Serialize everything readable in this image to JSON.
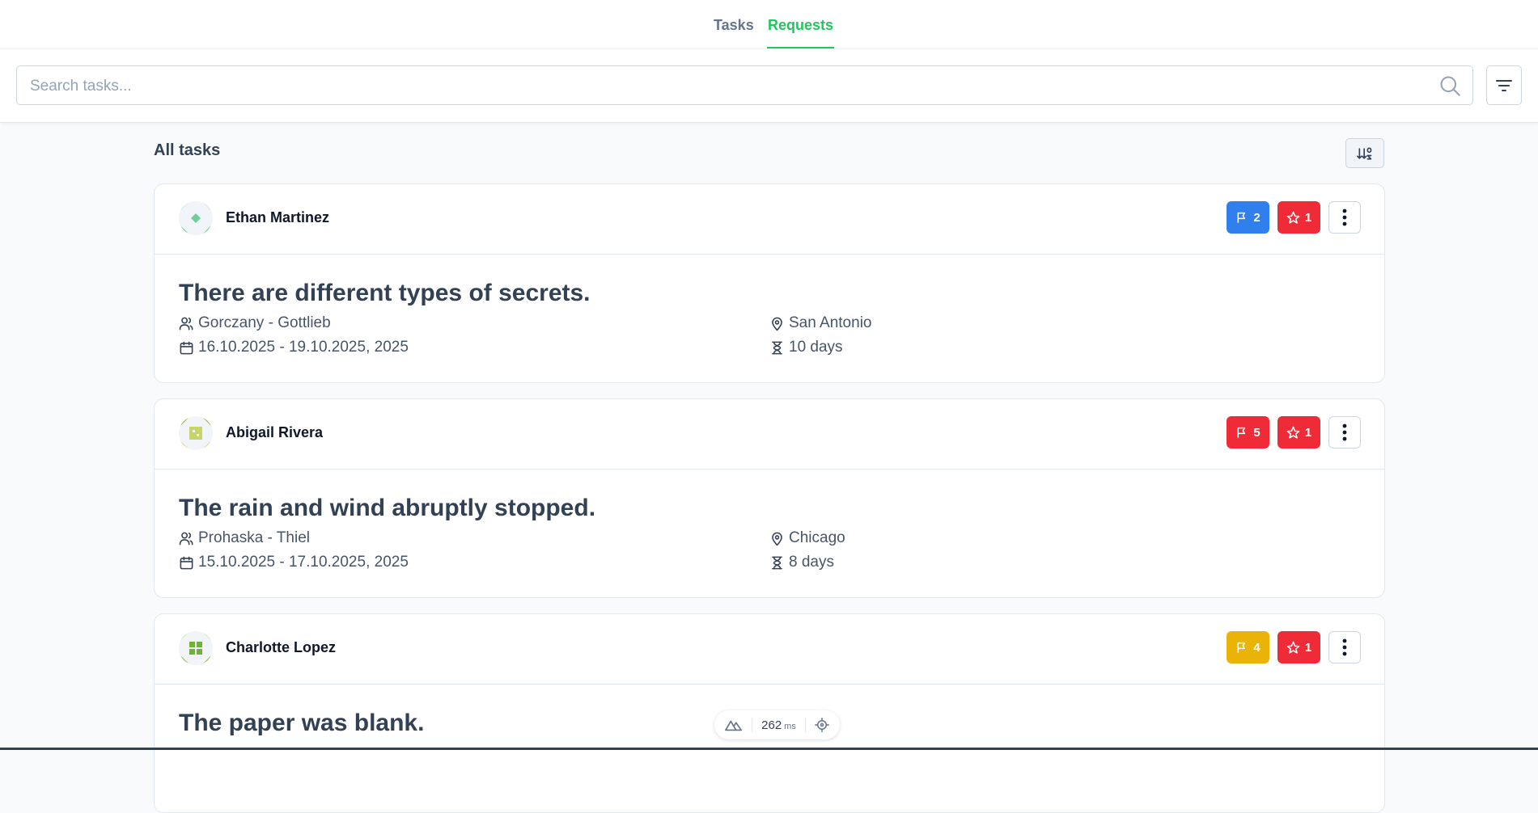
{
  "nav": {
    "tabs": [
      {
        "label": "Tasks",
        "active": false
      },
      {
        "label": "Requests",
        "active": true
      }
    ]
  },
  "search": {
    "placeholder": "Search tasks...",
    "value": ""
  },
  "section": {
    "title": "All tasks"
  },
  "cards": [
    {
      "author": "Ethan Martinez",
      "flag_count": "2",
      "flag_color": "blue",
      "star_count": "1",
      "title": "There are different types of secrets.",
      "company": "Gorczany - Gottlieb",
      "dates": "16.10.2025 - 19.10.2025, 2025",
      "location": "San Antonio",
      "duration": "10 days"
    },
    {
      "author": "Abigail Rivera",
      "flag_count": "5",
      "flag_color": "red",
      "star_count": "1",
      "title": "The rain and wind abruptly stopped.",
      "company": "Prohaska - Thiel",
      "dates": "15.10.2025 - 17.10.2025, 2025",
      "location": "Chicago",
      "duration": "8 days"
    },
    {
      "author": "Charlotte Lopez",
      "flag_count": "4",
      "flag_color": "yellow",
      "star_count": "1",
      "title": "The paper was blank."
    }
  ],
  "perf": {
    "value": "262",
    "unit": "ms"
  },
  "colors": {
    "accent": "#22c55e",
    "badge_blue": "#2f80ed",
    "badge_red": "#ef2b38",
    "badge_yellow": "#eab308"
  }
}
